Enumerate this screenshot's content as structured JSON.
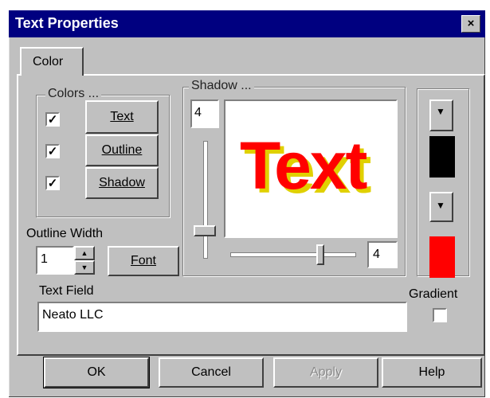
{
  "window": {
    "title": "Text Properties",
    "close_label": "×"
  },
  "tabs": [
    {
      "label": "Color"
    }
  ],
  "colors_group": {
    "label": "Colors ...",
    "buttons": {
      "text": "Text",
      "outline": "Outline",
      "shadow": "Shadow"
    },
    "checkboxes": {
      "text_checked": true,
      "outline_checked": true,
      "shadow_checked": true,
      "mark": "✓"
    }
  },
  "shadow_group": {
    "label": "Shadow ...",
    "top_value": "4",
    "bottom_value": "4",
    "preview_text": "Text",
    "preview_color": "#ff0000",
    "preview_shadow_color": "#e0d000"
  },
  "outline": {
    "label": "Outline Width",
    "value": "1",
    "font_button": "Font"
  },
  "text_field": {
    "label": "Text Field",
    "value": "Neato LLC"
  },
  "swatches": {
    "top_color": "#000000",
    "bottom_color": "#ff0000",
    "arrow": "▼"
  },
  "gradient": {
    "label": "Gradient",
    "checked": false
  },
  "footer": {
    "ok": "OK",
    "cancel": "Cancel",
    "apply": "Apply",
    "help": "Help"
  }
}
